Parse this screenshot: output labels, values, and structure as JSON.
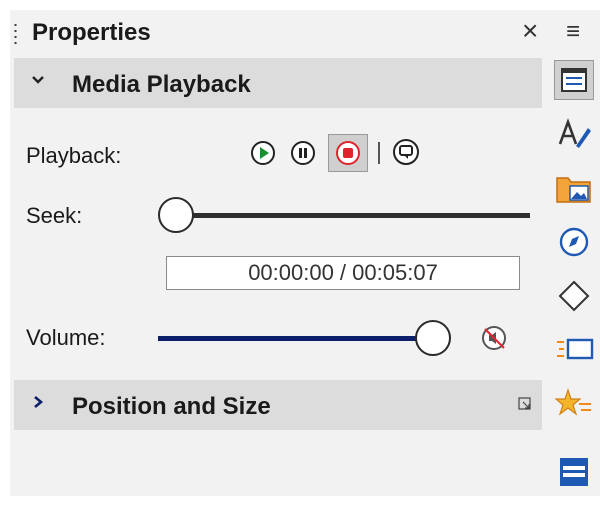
{
  "panel": {
    "title": "Properties",
    "close_label": "×",
    "menu_label": "≡"
  },
  "media_playback": {
    "header": "Media Playback",
    "playback_label": "Playback:",
    "seek_label": "Seek:",
    "time_value": "00:00:00 / 00:05:07",
    "seek_position": 0.0,
    "volume_label": "Volume:",
    "volume_level": 0.93,
    "buttons": [
      "play-icon",
      "pause-icon",
      "stop-icon",
      "repeat-icon"
    ],
    "mute_icon": "mute-icon"
  },
  "position_size": {
    "header": "Position and Size"
  },
  "sidebar": {
    "icons": [
      "properties-deck-icon",
      "styles-icon",
      "gallery-icon",
      "navigator-icon",
      "shapes-icon",
      "slide-transition-icon",
      "animation-icon",
      "master-slides-icon"
    ]
  },
  "colors": {
    "accent_track": "#0b1f6b",
    "play": "#1a8f2e",
    "stop": "#e0242b"
  }
}
